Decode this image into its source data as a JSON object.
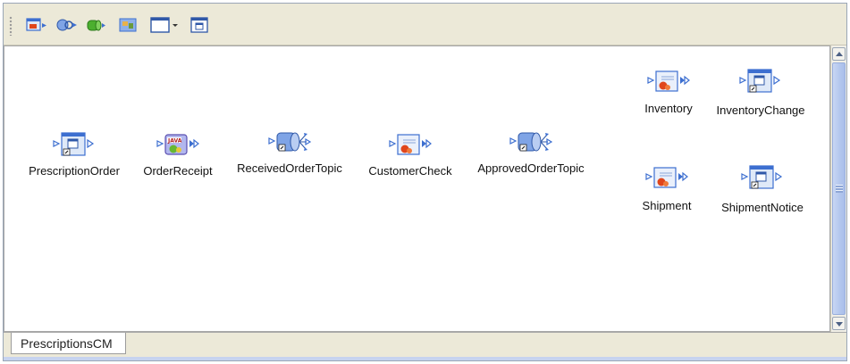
{
  "window": {
    "tab_label": "PrescriptionsCM"
  },
  "toolbar": {
    "buttons": [
      {
        "name": "add-external-application-button",
        "icon": "external-app-icon"
      },
      {
        "name": "add-web-service-button",
        "icon": "web-service-icon"
      },
      {
        "name": "add-database-button",
        "icon": "database-icon"
      },
      {
        "name": "add-image-button",
        "icon": "image-icon"
      },
      {
        "name": "window-dropdown-button",
        "icon": "window-dropdown-icon"
      },
      {
        "name": "new-document-button",
        "icon": "document-icon"
      }
    ]
  },
  "canvas": {
    "nodes": [
      {
        "label": "PrescriptionOrder",
        "icon": "external-document-icon"
      },
      {
        "label": "OrderReceipt",
        "icon": "java-service-icon"
      },
      {
        "label": "ReceivedOrderTopic",
        "icon": "topic-icon"
      },
      {
        "label": "CustomerCheck",
        "icon": "service-icon"
      },
      {
        "label": "ApprovedOrderTopic",
        "icon": "topic-icon"
      },
      {
        "label": "Inventory",
        "icon": "service-icon"
      },
      {
        "label": "InventoryChange",
        "icon": "external-document-icon"
      },
      {
        "label": "Shipment",
        "icon": "service-icon"
      },
      {
        "label": "ShipmentNotice",
        "icon": "external-document-icon"
      }
    ]
  },
  "colors": {
    "toolbar_bg": "#ece9d8",
    "scroll_thumb": "#b6c9ee",
    "accent_blue": "#3d6fd0",
    "service_red": "#e0461c"
  }
}
